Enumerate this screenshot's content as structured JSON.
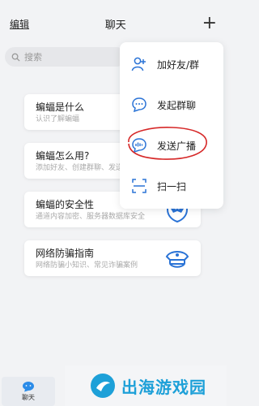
{
  "header": {
    "edit_label": "编辑",
    "title": "聊天",
    "add_symbol": "+"
  },
  "search": {
    "placeholder": "搜索"
  },
  "cards": [
    {
      "title": "蝙蝠是什么",
      "subtitle": "认识了解蝙蝠"
    },
    {
      "title": "蝙蝠怎么用?",
      "subtitle": "添加好友、创建群聊、发送..."
    },
    {
      "title": "蝙蝠的安全性",
      "subtitle": "通道内容加密、服务器数据库安全"
    },
    {
      "title": "网络防骗指南",
      "subtitle": "网络防骗小知识、常见诈骗案例"
    }
  ],
  "menu": {
    "items": [
      {
        "label": "加好友/群",
        "icon": "add-friend-icon"
      },
      {
        "label": "发起群聊",
        "icon": "group-chat-icon"
      },
      {
        "label": "发送广播",
        "icon": "broadcast-icon"
      },
      {
        "label": "扫一扫",
        "icon": "scan-icon"
      }
    ]
  },
  "tabbar": {
    "chat_label": "聊天"
  },
  "watermark": {
    "text": "出海游戏园"
  },
  "colors": {
    "accent": "#2a73d6",
    "highlight": "#d62828",
    "watermark": "#1da0d8"
  }
}
